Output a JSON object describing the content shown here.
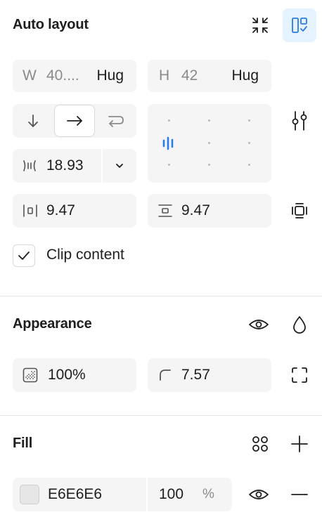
{
  "auto_layout": {
    "title": "Auto layout",
    "width_label": "W",
    "width_value": "40....",
    "width_mode": "Hug",
    "height_label": "H",
    "height_value": "42",
    "height_mode": "Hug",
    "gap_value": "18.93",
    "padding_h": "9.47",
    "padding_v": "9.47",
    "clip_label": "Clip content",
    "clip_checked": true,
    "direction_selected": "horizontal"
  },
  "appearance": {
    "title": "Appearance",
    "opacity": "100%",
    "radius": "7.57"
  },
  "fill": {
    "title": "Fill",
    "hex": "E6E6E6",
    "opacity": "100",
    "percent": "%",
    "swatch_color": "#E6E6E6"
  },
  "colors": {
    "accent": "#2c7be5",
    "active_bg": "#e5f2ff",
    "field_bg": "#f5f5f5"
  }
}
